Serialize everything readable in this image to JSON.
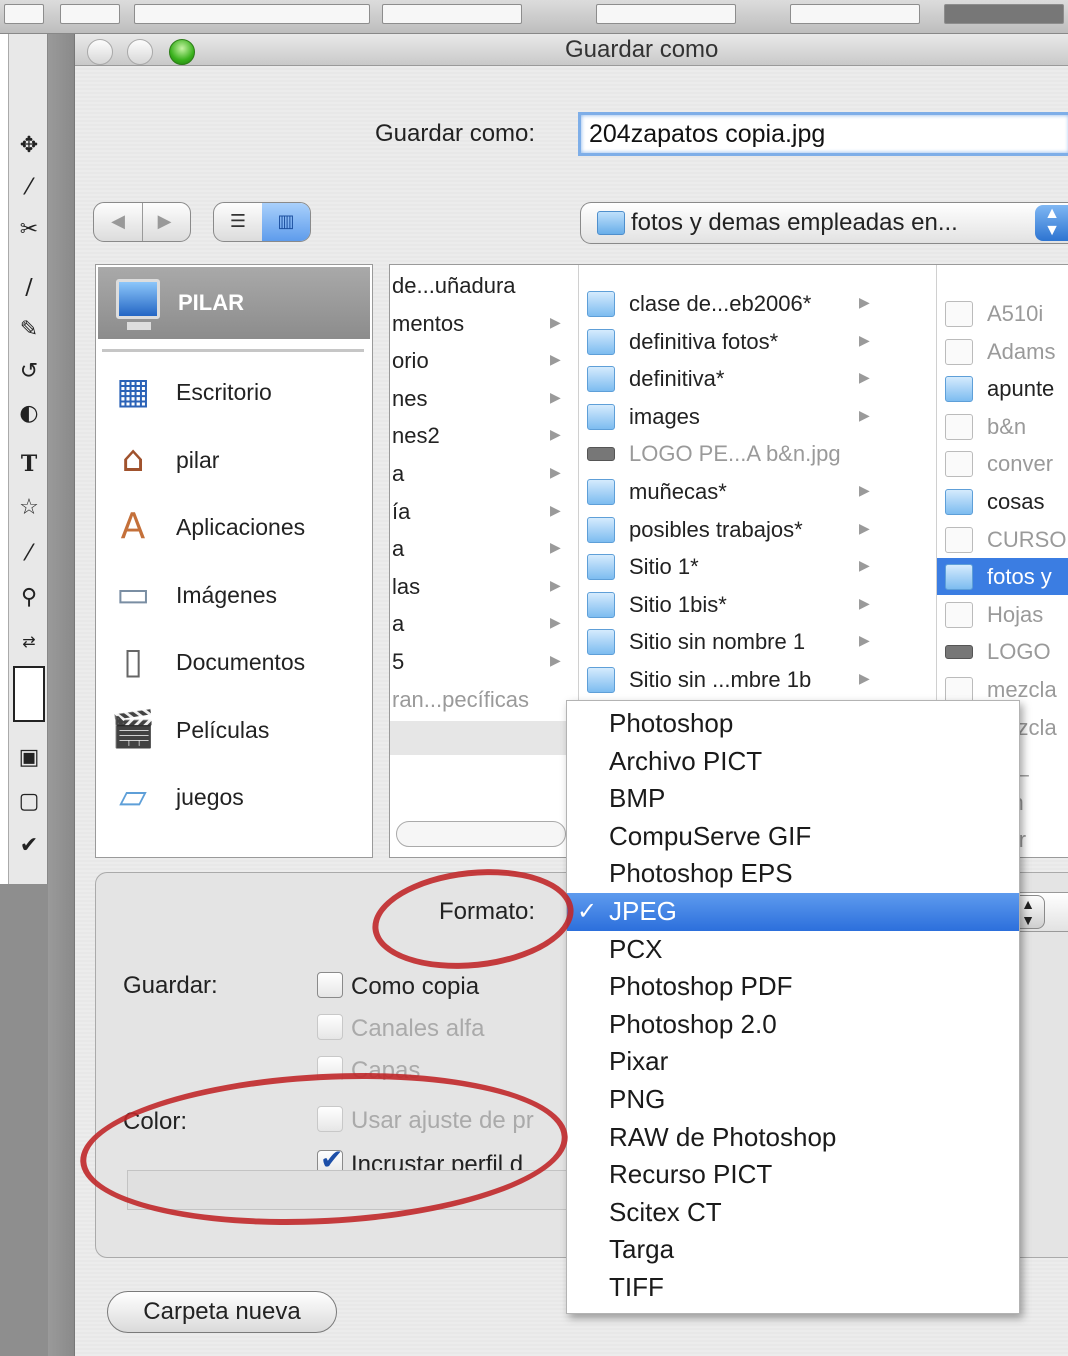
{
  "dialog": {
    "title": "Guardar como",
    "save_as_label": "Guardar como:",
    "filename_value": "204zapatos copia.jpg",
    "location": "fotos y demas empleadas en..."
  },
  "nav": {
    "back_icon": "back-arrow-icon",
    "forward_icon": "forward-arrow-icon",
    "list_view_icon": "list-view-icon",
    "column_view_icon": "column-view-icon"
  },
  "sidebar": {
    "header": "PILAR",
    "items": [
      {
        "label": "Escritorio",
        "icon": "desktop-icon"
      },
      {
        "label": "pilar",
        "icon": "home-icon"
      },
      {
        "label": "Aplicaciones",
        "icon": "applications-icon"
      },
      {
        "label": "Imágenes",
        "icon": "pictures-icon"
      },
      {
        "label": "Documentos",
        "icon": "documents-icon"
      },
      {
        "label": "Películas",
        "icon": "movies-icon"
      },
      {
        "label": "juegos",
        "icon": "folder-icon"
      }
    ]
  },
  "columns": {
    "col1": [
      "de...uñadura",
      "mentos",
      "orio",
      "nes",
      "nes2",
      "a",
      "ía",
      "a",
      "las",
      "a",
      "5",
      "ran...pecíficas"
    ],
    "col2": [
      {
        "label": "clase de...eb2006*",
        "kind": "folder"
      },
      {
        "label": "definitiva fotos*",
        "kind": "folder"
      },
      {
        "label": "definitiva*",
        "kind": "folder"
      },
      {
        "label": "images",
        "kind": "folder"
      },
      {
        "label": "LOGO PE...A b&n.jpg",
        "kind": "image"
      },
      {
        "label": "muñecas*",
        "kind": "folder"
      },
      {
        "label": "posibles trabajos*",
        "kind": "folder"
      },
      {
        "label": "Sitio  1*",
        "kind": "folder"
      },
      {
        "label": "Sitio 1bis*",
        "kind": "folder"
      },
      {
        "label": "Sitio sin nombre 1",
        "kind": "folder"
      },
      {
        "label": "Sitio sin ...mbre 1b",
        "kind": "folder"
      }
    ],
    "col3": [
      {
        "label": "A510i",
        "kind": "file"
      },
      {
        "label": "Adams",
        "kind": "file"
      },
      {
        "label": "apunte",
        "kind": "folder"
      },
      {
        "label": "b&n",
        "kind": "file"
      },
      {
        "label": "conver",
        "kind": "file"
      },
      {
        "label": "cosas",
        "kind": "folder"
      },
      {
        "label": "CURSO",
        "kind": "file"
      },
      {
        "label": "fotos y",
        "kind": "folder",
        "selected": true
      },
      {
        "label": "Hojas",
        "kind": "file"
      },
      {
        "label": "LOGO",
        "kind": "image"
      },
      {
        "label": "mezcla",
        "kind": "file"
      },
      {
        "label": "mezcla",
        "kind": "file"
      },
      {
        "label": "bla_",
        "kind": "file"
      },
      {
        "label": "t en",
        "kind": "file"
      },
      {
        "label": "tor r",
        "kind": "file"
      }
    ]
  },
  "options": {
    "format_label": "Formato:",
    "format_value": "JPEG",
    "save_label": "Guardar:",
    "color_label": "Color:",
    "checkboxes": [
      {
        "label": "Como copia",
        "checked": false,
        "enabled": true
      },
      {
        "label": "Canales alfa",
        "checked": false,
        "enabled": false
      },
      {
        "label": "Capas",
        "checked": false,
        "enabled": false
      },
      {
        "label": "Usar ajuste de pr",
        "checked": false,
        "enabled": false
      },
      {
        "label": "Incrustar perfil d",
        "checked": true,
        "enabled": true
      }
    ]
  },
  "format_menu": {
    "items": [
      "Photoshop",
      "Archivo PICT",
      "BMP",
      "CompuServe GIF",
      "Photoshop EPS",
      "JPEG",
      "PCX",
      "Photoshop PDF",
      "Photoshop 2.0",
      "Pixar",
      "PNG",
      "RAW de Photoshop",
      "Recurso PICT",
      "Scitex CT",
      "Targa",
      "TIFF"
    ],
    "selected": "JPEG",
    "check_glyph": "✓"
  },
  "buttons": {
    "new_folder": "Carpeta nueva"
  },
  "colors": {
    "selection_blue": "#3b7de2",
    "annotation_red": "#c0282a",
    "focus_ring": "#7eaee8"
  }
}
